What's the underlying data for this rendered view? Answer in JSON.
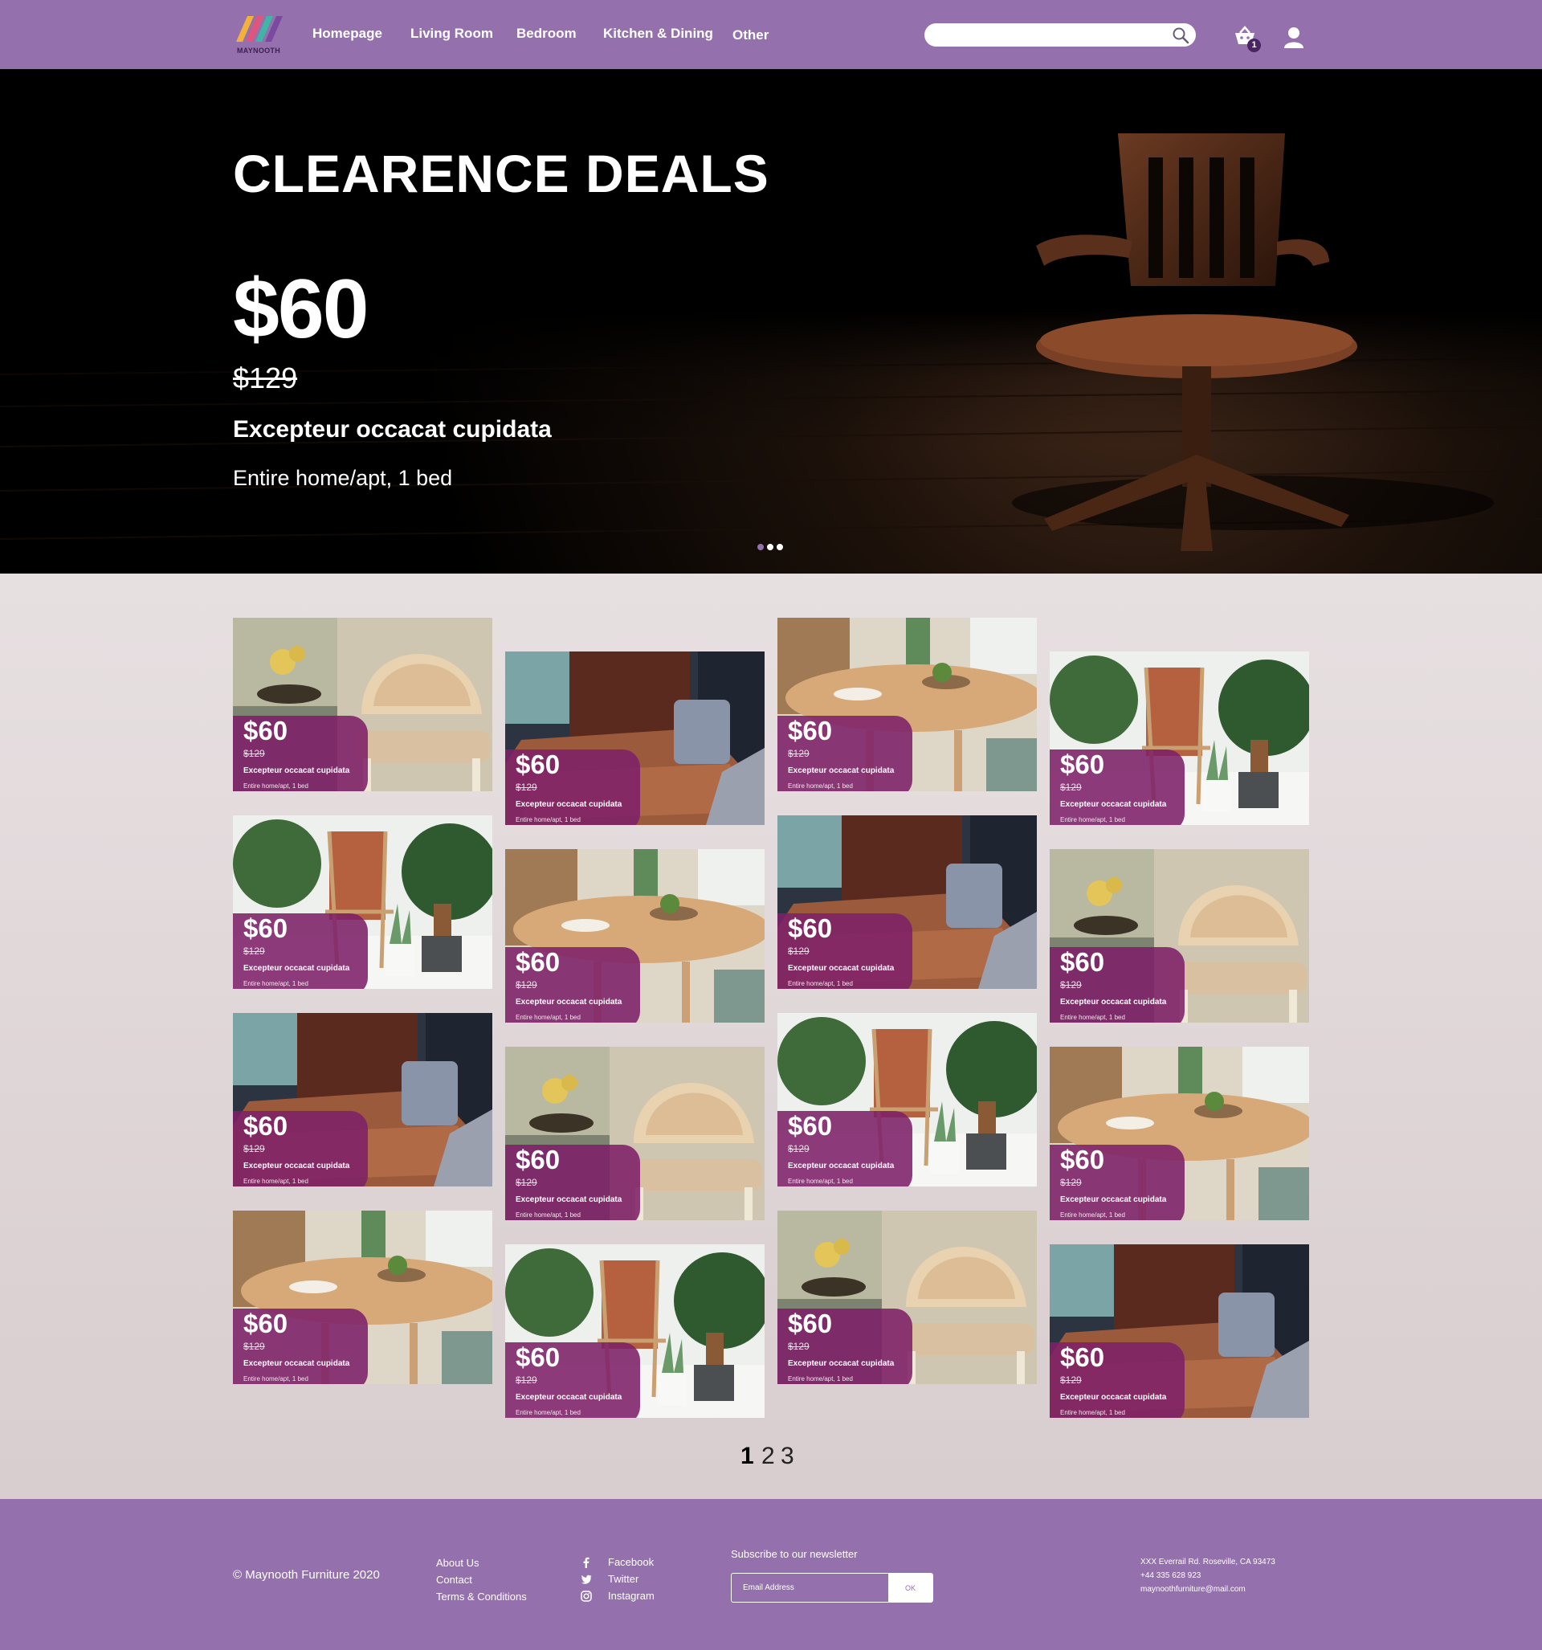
{
  "brand": {
    "name": "MAYNOOTH"
  },
  "nav": {
    "items": [
      "Homepage",
      "Living Room",
      "Bedroom",
      "Kitchen & Dining",
      "Other"
    ]
  },
  "search": {
    "placeholder": ""
  },
  "cart": {
    "count": "1"
  },
  "hero": {
    "title": "CLEARENCE DEALS",
    "price": "$60",
    "old_price": "$129",
    "name": "Excepteur occacat cupidata",
    "subtitle": "Entire home/apt, 1 bed",
    "slides": 3,
    "active_slide": 0
  },
  "products": [
    {
      "img": "armchair",
      "price": "$60",
      "old_price": "$129",
      "name": "Excepteur occacat cupidata",
      "sub": "Entire home/apt, 1 bed"
    },
    {
      "img": "sofa",
      "price": "$60",
      "old_price": "$129",
      "name": "Excepteur occacat cupidata",
      "sub": "Entire home/apt, 1 bed"
    },
    {
      "img": "table",
      "price": "$60",
      "old_price": "$129",
      "name": "Excepteur occacat cupidata",
      "sub": "Entire home/apt, 1 bed"
    },
    {
      "img": "plants",
      "price": "$60",
      "old_price": "$129",
      "name": "Excepteur occacat cupidata",
      "sub": "Entire home/apt, 1 bed"
    },
    {
      "img": "plants",
      "price": "$60",
      "old_price": "$129",
      "name": "Excepteur occacat cupidata",
      "sub": "Entire home/apt, 1 bed"
    },
    {
      "img": "table",
      "price": "$60",
      "old_price": "$129",
      "name": "Excepteur occacat cupidata",
      "sub": "Entire home/apt, 1 bed"
    },
    {
      "img": "sofa",
      "price": "$60",
      "old_price": "$129",
      "name": "Excepteur occacat cupidata",
      "sub": "Entire home/apt, 1 bed"
    },
    {
      "img": "armchair",
      "price": "$60",
      "old_price": "$129",
      "name": "Excepteur occacat cupidata",
      "sub": "Entire home/apt, 1 bed"
    },
    {
      "img": "sofa",
      "price": "$60",
      "old_price": "$129",
      "name": "Excepteur occacat cupidata",
      "sub": "Entire home/apt, 1 bed"
    },
    {
      "img": "armchair",
      "price": "$60",
      "old_price": "$129",
      "name": "Excepteur occacat cupidata",
      "sub": "Entire home/apt, 1 bed"
    },
    {
      "img": "plants",
      "price": "$60",
      "old_price": "$129",
      "name": "Excepteur occacat cupidata",
      "sub": "Entire home/apt, 1 bed"
    },
    {
      "img": "table",
      "price": "$60",
      "old_price": "$129",
      "name": "Excepteur occacat cupidata",
      "sub": "Entire home/apt, 1 bed"
    },
    {
      "img": "table",
      "price": "$60",
      "old_price": "$129",
      "name": "Excepteur occacat cupidata",
      "sub": "Entire home/apt, 1 bed"
    },
    {
      "img": "plants",
      "price": "$60",
      "old_price": "$129",
      "name": "Excepteur occacat cupidata",
      "sub": "Entire home/apt, 1 bed"
    },
    {
      "img": "armchair",
      "price": "$60",
      "old_price": "$129",
      "name": "Excepteur occacat cupidata",
      "sub": "Entire home/apt, 1 bed"
    },
    {
      "img": "sofa",
      "price": "$60",
      "old_price": "$129",
      "name": "Excepteur occacat cupidata",
      "sub": "Entire home/apt, 1 bed"
    }
  ],
  "pagination": {
    "pages": [
      "1",
      "2",
      "3"
    ],
    "current": "1"
  },
  "footer": {
    "copyright": "© Maynooth Furniture 2020",
    "links": [
      "About Us",
      "Contact",
      "Terms & Conditions"
    ],
    "social": [
      {
        "icon": "facebook-icon",
        "label": "Facebook"
      },
      {
        "icon": "twitter-icon",
        "label": "Twitter"
      },
      {
        "icon": "instagram-icon",
        "label": "Instagram"
      }
    ],
    "newsletter": {
      "label": "Subscribe to our newsletter",
      "placeholder": "Email Address",
      "button": "OK"
    },
    "address": [
      "XXX Everrail Rd. Roseville, CA 93473",
      "+44 335 628 923",
      "maynoothfurniture@mail.com"
    ]
  },
  "colors": {
    "brand": "#9470ad",
    "tag": "#7d2068",
    "grid_bg": "#e6dedf"
  }
}
